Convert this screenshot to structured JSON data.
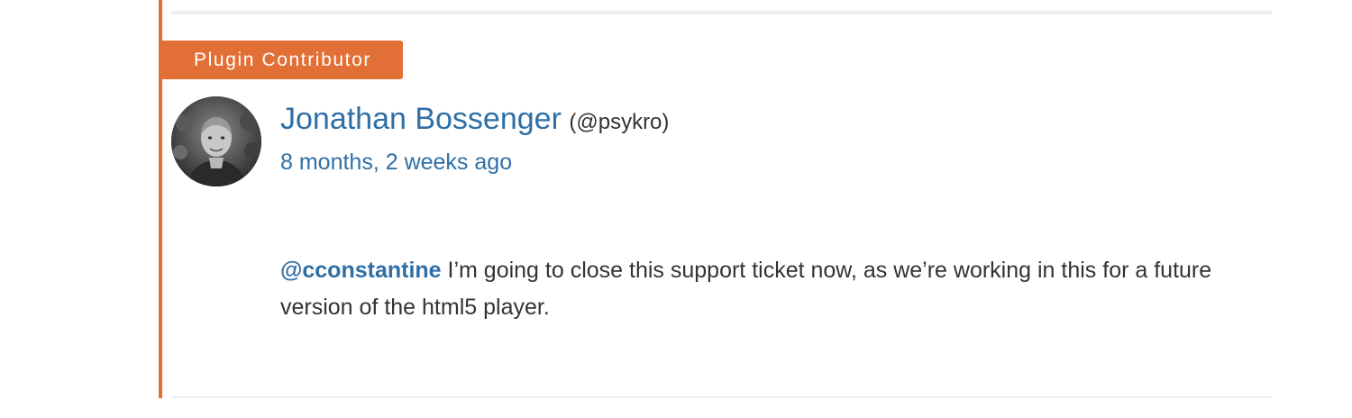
{
  "badge": {
    "label": "Plugin Contributor",
    "color": "#e26f36"
  },
  "author": {
    "name": "Jonathan Bossenger",
    "handle": "(@psykro)",
    "avatar_icon": "user-avatar-photo"
  },
  "timestamp": "8 months, 2 weeks ago",
  "message": {
    "mention": "@cconstantine",
    "text": " I’m going to close this support ticket now, as we’re working in this for a future version of the html5 player."
  },
  "colors": {
    "link": "#2f6fa6",
    "text": "#333333",
    "accent": "#e26f36",
    "divider": "#eeeeee"
  }
}
